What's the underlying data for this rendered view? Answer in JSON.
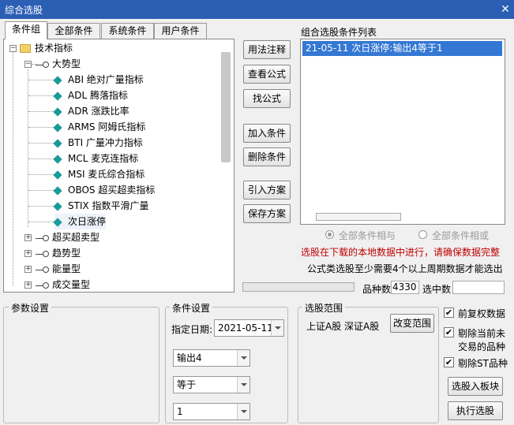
{
  "window": {
    "title": "综合选股",
    "close_label": "✕"
  },
  "tabs": [
    {
      "label": "条件组",
      "active": true
    },
    {
      "label": "全部条件",
      "active": false
    },
    {
      "label": "系统条件",
      "active": false
    },
    {
      "label": "用户条件",
      "active": false
    }
  ],
  "tree": {
    "root": "技术指标",
    "group_expanded": "大势型",
    "leaves": [
      "ABI 绝对广量指标",
      "ADL 腾落指标",
      "ADR 涨跌比率",
      "ARMS 阿姆氏指标",
      "BTI 广量冲力指标",
      "MCL 麦克连指标",
      "MSI 麦氏综合指标",
      "OBOS 超买超卖指标",
      "STIX 指数平滑广量",
      "次日涨停"
    ],
    "collapsed_groups": [
      "超买超卖型",
      "趋势型",
      "能量型",
      "成交量型"
    ]
  },
  "buttons": {
    "usage": "用法注释",
    "view_formula": "查看公式",
    "find_formula": "找公式",
    "add_condition": "加入条件",
    "delete_condition": "删除条件",
    "import_plan": "引入方案",
    "save_plan": "保存方案",
    "change_range": "改变范围",
    "to_block": "选股入板块",
    "execute": "执行选股"
  },
  "condition_list": {
    "title": "组合选股条件列表",
    "items": [
      "21-05-11 次日涨停:输出4等于1"
    ]
  },
  "logic": {
    "and_label": "全部条件相与",
    "or_label": "全部条件相或",
    "selected": "and"
  },
  "warning": "选股在下载的本地数据中进行，请确保数据完整",
  "hint": "公式类选股至少需要4个以上周期数据才能选出",
  "counts": {
    "stock_count_label": "品种数",
    "stock_count": "4330",
    "selected_count_label": "选中数",
    "selected_count": ""
  },
  "params": {
    "title": "参数设置"
  },
  "condition_settings": {
    "title": "条件设置",
    "date_label": "指定日期:",
    "date": "2021-05-11",
    "output": "输出4",
    "operator": "等于",
    "value": "1"
  },
  "range": {
    "title": "选股范围",
    "text": "上证A股 深证A股"
  },
  "options": [
    {
      "label": "前复权数据",
      "checked": true
    },
    {
      "label": "剔除当前未",
      "label2": "交易的品种",
      "checked": true
    },
    {
      "label": "剔除ST品种",
      "checked": true
    }
  ]
}
